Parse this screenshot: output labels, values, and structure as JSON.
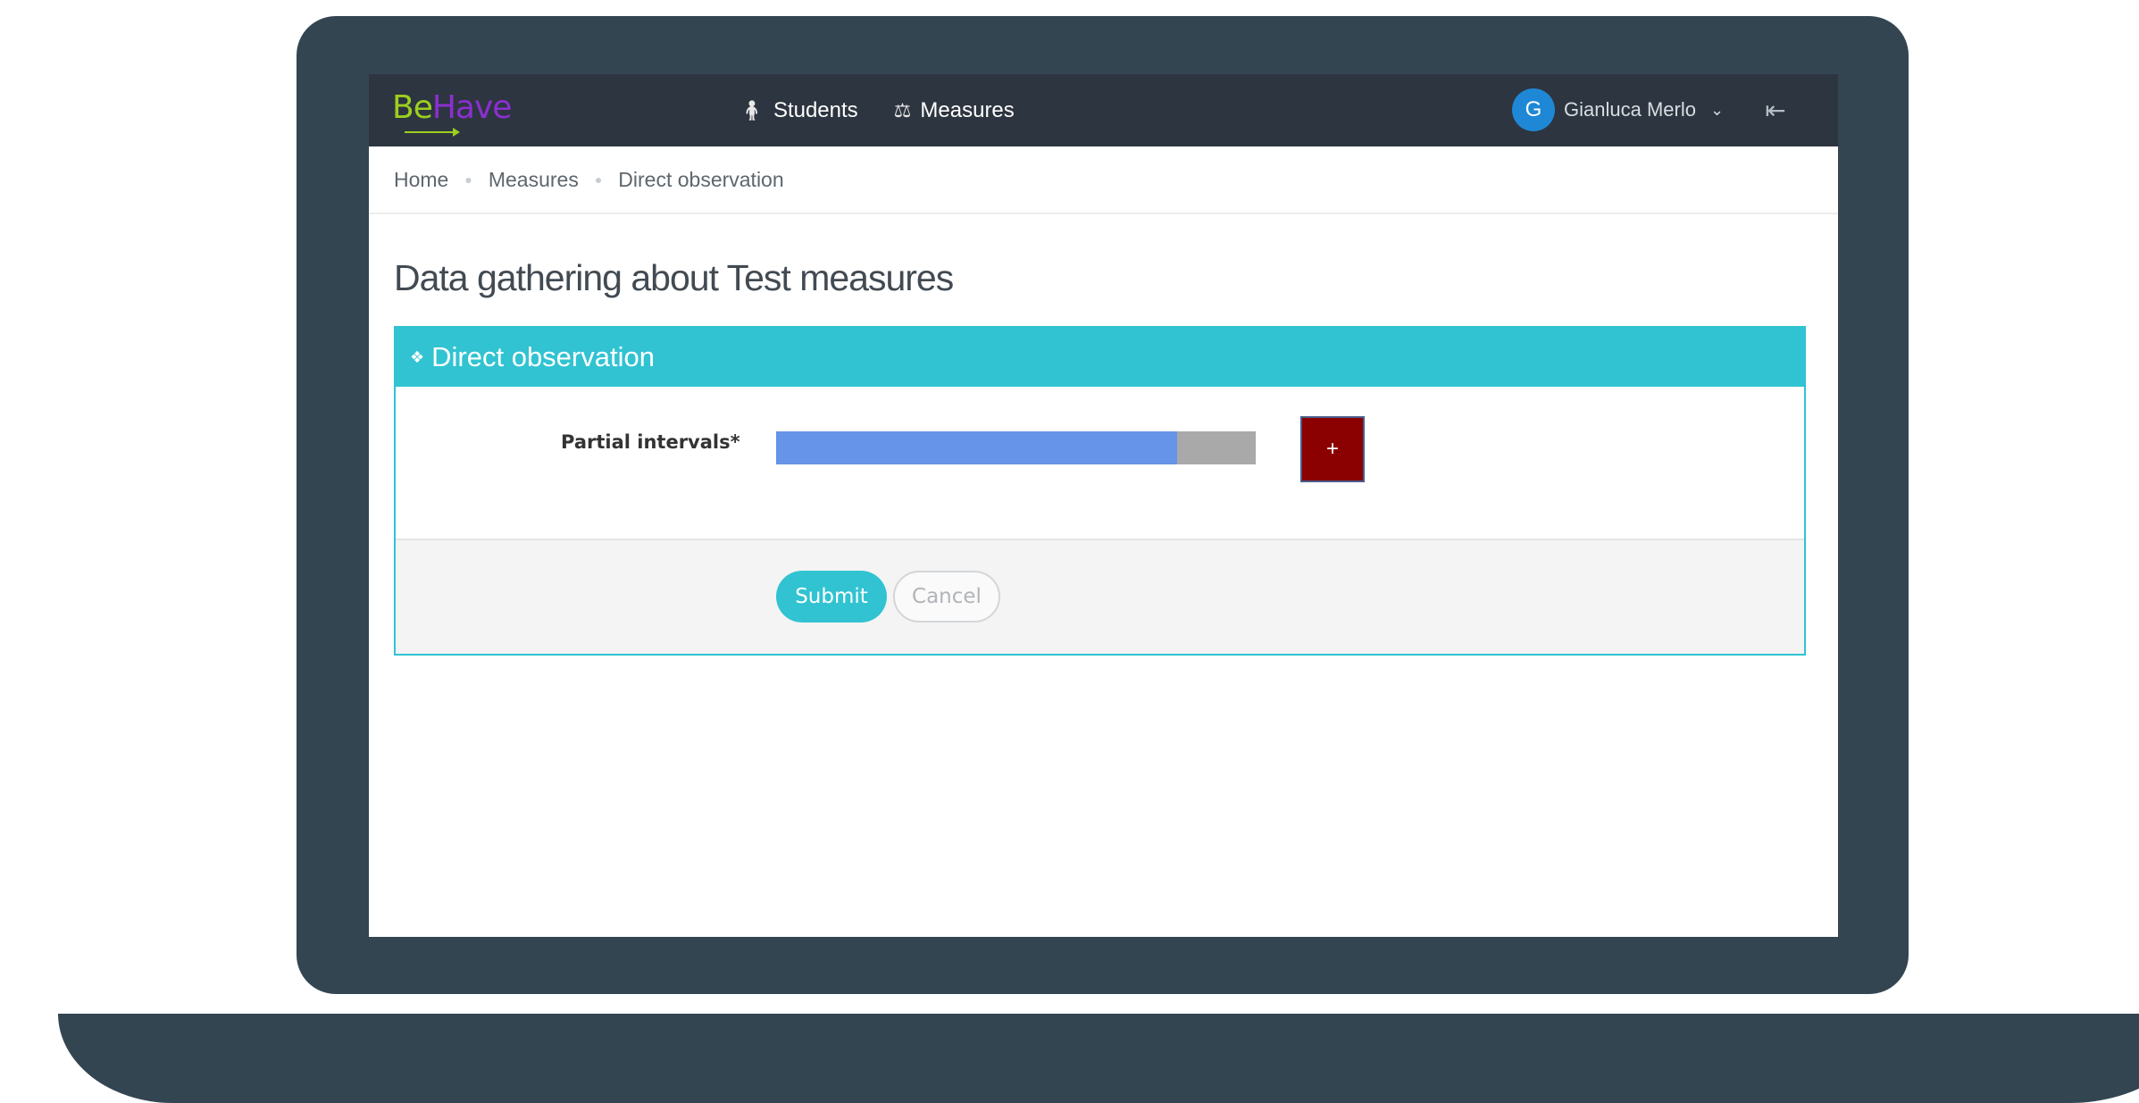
{
  "brand": {
    "logo_be": "Be",
    "logo_have": "Have"
  },
  "nav": {
    "items": [
      {
        "label": "Students",
        "icon": "student-icon"
      },
      {
        "label": "Measures",
        "icon": "scale-icon"
      }
    ],
    "user": {
      "initial": "G",
      "name": "Gianluca Merlo"
    }
  },
  "breadcrumb": [
    "Home",
    "Measures",
    "Direct observation"
  ],
  "page": {
    "title": "Data gathering about Test measures"
  },
  "panel": {
    "title": "Direct observation",
    "field": {
      "label": "Partial intervals*",
      "progress_fraction": 0.836
    },
    "add_label": "+",
    "submit_label": "Submit",
    "cancel_label": "Cancel"
  },
  "colors": {
    "navbar": "#2d3540",
    "accent": "#31c3d2",
    "progress_fill": "#6594e8",
    "progress_track": "#a9a9a9",
    "add_button": "#8b0000",
    "laptop": "#344552"
  }
}
